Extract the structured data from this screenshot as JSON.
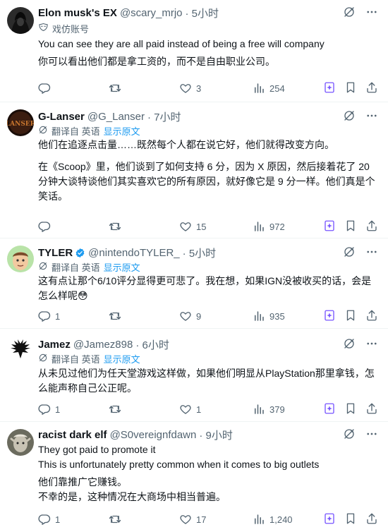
{
  "colors": {
    "accent": "#1d9bf0",
    "muted": "#536471",
    "text": "#0f1419",
    "divider": "#eff3f4"
  },
  "posts": [
    {
      "name": "Elon musk's EX",
      "handle": "@scary_mrjo",
      "time": "· 5小时",
      "parody_label": "戏仿账号",
      "text": [
        "You can see they are all paid instead of being a free will company",
        "你可以看出他们都是拿工资的，而不是自由职业公司。"
      ],
      "stats": {
        "replies": "",
        "retweets": "",
        "likes": "3",
        "views": "254"
      }
    },
    {
      "name": "G-Lanser",
      "handle": "@G_Lanser",
      "time": "· 7小时",
      "translated_from": "翻译自 英语",
      "show_original": "显示原文",
      "text": [
        "他们在追逐点击量……既然每个人都在说它好，他们就得改变方向。",
        "在《Scoop》里，他们谈到了如何支持 6 分，因为 X 原因，然后接着花了 20 分钟大谈特谈他们其实喜欢它的所有原因，就好像它是 9 分一样。他们真是个笑话。"
      ],
      "stats": {
        "replies": "",
        "retweets": "",
        "likes": "15",
        "views": "972"
      }
    },
    {
      "name": "TYLER",
      "handle": "@nintendoTYLER_",
      "time": "· 5小时",
      "translated_from": "翻译自 英语",
      "show_original": "显示原文",
      "text": [
        "这有点让那个6/10评分显得更可悲了。我在想，如果IGN没被收买的话，会是怎么样呢😳"
      ],
      "stats": {
        "replies": "1",
        "retweets": "",
        "likes": "9",
        "views": "935"
      }
    },
    {
      "name": "Jamez",
      "handle": "@Jamez898",
      "time": "· 6小时",
      "translated_from": "翻译自 英语",
      "show_original": "显示原文",
      "text": [
        "从未见过他们为任天堂游戏这样做，如果他们明显从PlayStation那里拿钱，怎么能声称自己公正呢。"
      ],
      "stats": {
        "replies": "1",
        "retweets": "",
        "likes": "1",
        "views": "379"
      }
    },
    {
      "name": "racist dark elf",
      "handle": "@S0vereignfdawn",
      "time": "· 9小时",
      "text": [
        "They got paid to promote it",
        "This is unfortunately pretty common when it comes to big outlets",
        "他们靠推广它赚钱。",
        "不幸的是，这种情况在大商场中相当普遍。"
      ],
      "stats": {
        "replies": "1",
        "retweets": "",
        "likes": "17",
        "views": "1,240"
      }
    }
  ]
}
